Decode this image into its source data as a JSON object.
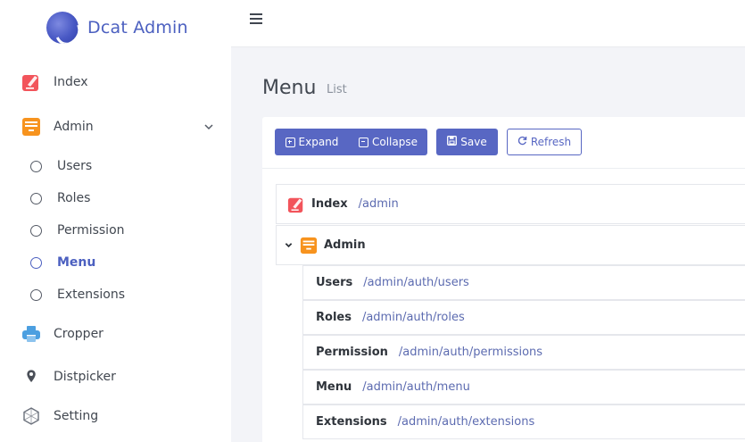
{
  "brand": {
    "name": "Dcat Admin"
  },
  "sidebar": {
    "items": [
      {
        "label": "Index",
        "icon": "edit-square-icon"
      },
      {
        "label": "Admin",
        "icon": "archive-icon"
      },
      {
        "label": "Cropper",
        "icon": "printer-icon"
      },
      {
        "label": "Distpicker",
        "icon": "map-pin-icon"
      },
      {
        "label": "Setting",
        "icon": "hexagon-icon"
      }
    ],
    "sub_items": [
      {
        "label": "Users"
      },
      {
        "label": "Roles"
      },
      {
        "label": "Permission"
      },
      {
        "label": "Menu"
      },
      {
        "label": "Extensions"
      }
    ]
  },
  "page": {
    "title": "Menu",
    "subtitle": "List"
  },
  "toolbar": {
    "expand_label": "Expand",
    "collapse_label": "Collapse",
    "save_label": "Save",
    "refresh_label": "Refresh"
  },
  "tree": {
    "top": [
      {
        "title": "Index",
        "uri": "/admin"
      },
      {
        "title": "Admin",
        "uri": ""
      }
    ],
    "children": [
      {
        "title": "Users",
        "uri": "/admin/auth/users"
      },
      {
        "title": "Roles",
        "uri": "/admin/auth/roles"
      },
      {
        "title": "Permission",
        "uri": "/admin/auth/permissions"
      },
      {
        "title": "Menu",
        "uri": "/admin/auth/menu"
      },
      {
        "title": "Extensions",
        "uri": "/admin/auth/extensions"
      }
    ]
  },
  "colors": {
    "accent": "#5867c3",
    "index_icon": "#f2545b",
    "admin_icon": "#f7931e",
    "cropper_icon": "#4c9fe0"
  }
}
